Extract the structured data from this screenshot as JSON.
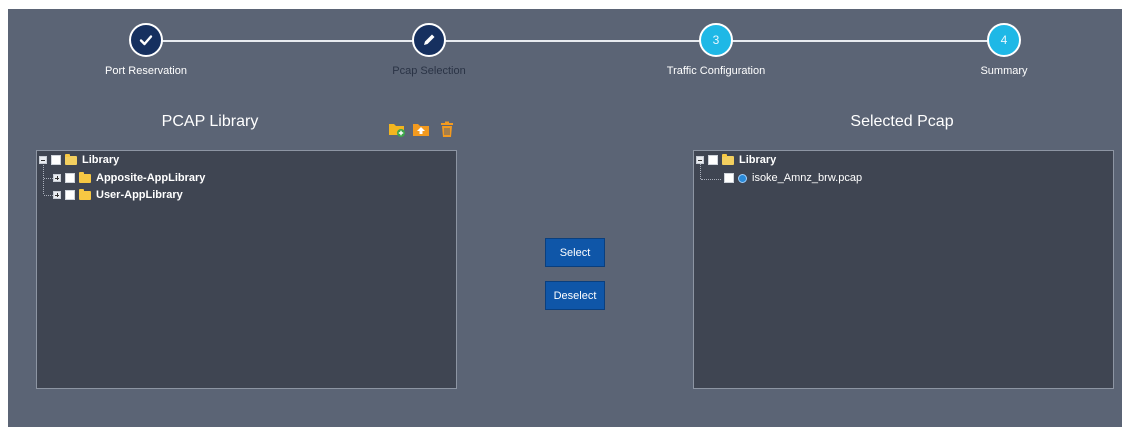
{
  "stepper": {
    "steps": [
      {
        "label": "Port Reservation",
        "number": "",
        "state": "done",
        "icon": "check-icon"
      },
      {
        "label": "Pcap Selection",
        "number": "",
        "state": "current",
        "icon": "pencil-icon"
      },
      {
        "label": "Traffic Configuration",
        "number": "3",
        "state": "todo",
        "icon": ""
      },
      {
        "label": "Summary",
        "number": "4",
        "state": "todo",
        "icon": ""
      }
    ]
  },
  "left": {
    "title": "PCAP Library",
    "toolbar": {
      "icons": [
        "add-folder-icon",
        "upload-icon",
        "trash-icon"
      ],
      "colors": {
        "folder": "#f3b51f",
        "upload": "#f39a1f",
        "trash": "#f39a1f"
      }
    },
    "tree": {
      "root": {
        "label": "Library",
        "expanded": true
      },
      "children": [
        {
          "label": "Apposite-AppLibrary",
          "expanded": false
        },
        {
          "label": "User-AppLibrary",
          "expanded": false
        }
      ]
    }
  },
  "actions": {
    "select_label": "Select",
    "deselect_label": "Deselect"
  },
  "right": {
    "title": "Selected Pcap",
    "tree": {
      "root": {
        "label": "Library",
        "expanded": true
      },
      "children": [
        {
          "label": "isoke_Amnz_brw.pcap"
        }
      ]
    }
  },
  "colors": {
    "panel_bg": "#5b6475",
    "tree_bg": "#3f4552",
    "done_step": "#16305f",
    "todo_step": "#1fb8e6",
    "button": "#0f56a8"
  }
}
